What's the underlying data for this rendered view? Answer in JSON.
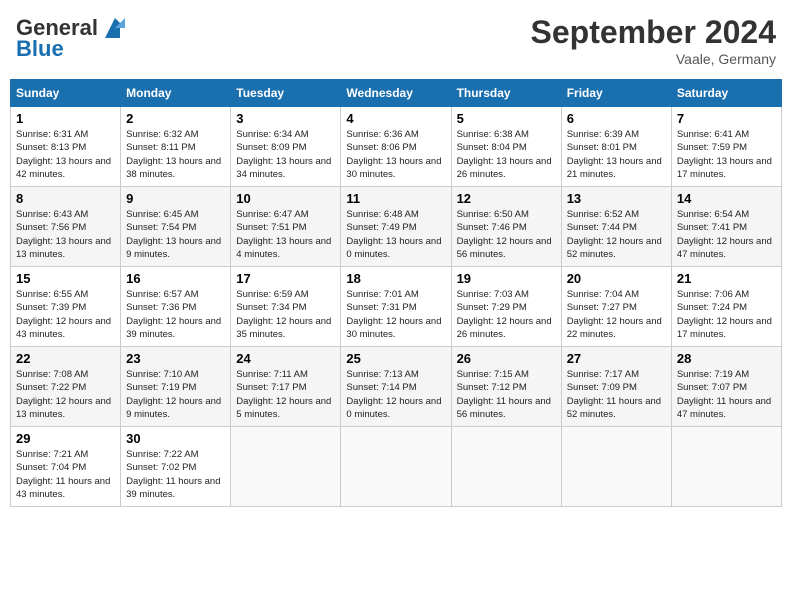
{
  "header": {
    "logo_general": "General",
    "logo_blue": "Blue",
    "month": "September 2024",
    "location": "Vaale, Germany"
  },
  "weekdays": [
    "Sunday",
    "Monday",
    "Tuesday",
    "Wednesday",
    "Thursday",
    "Friday",
    "Saturday"
  ],
  "weeks": [
    [
      {
        "day": "1",
        "sunrise": "Sunrise: 6:31 AM",
        "sunset": "Sunset: 8:13 PM",
        "daylight": "Daylight: 13 hours and 42 minutes."
      },
      {
        "day": "2",
        "sunrise": "Sunrise: 6:32 AM",
        "sunset": "Sunset: 8:11 PM",
        "daylight": "Daylight: 13 hours and 38 minutes."
      },
      {
        "day": "3",
        "sunrise": "Sunrise: 6:34 AM",
        "sunset": "Sunset: 8:09 PM",
        "daylight": "Daylight: 13 hours and 34 minutes."
      },
      {
        "day": "4",
        "sunrise": "Sunrise: 6:36 AM",
        "sunset": "Sunset: 8:06 PM",
        "daylight": "Daylight: 13 hours and 30 minutes."
      },
      {
        "day": "5",
        "sunrise": "Sunrise: 6:38 AM",
        "sunset": "Sunset: 8:04 PM",
        "daylight": "Daylight: 13 hours and 26 minutes."
      },
      {
        "day": "6",
        "sunrise": "Sunrise: 6:39 AM",
        "sunset": "Sunset: 8:01 PM",
        "daylight": "Daylight: 13 hours and 21 minutes."
      },
      {
        "day": "7",
        "sunrise": "Sunrise: 6:41 AM",
        "sunset": "Sunset: 7:59 PM",
        "daylight": "Daylight: 13 hours and 17 minutes."
      }
    ],
    [
      {
        "day": "8",
        "sunrise": "Sunrise: 6:43 AM",
        "sunset": "Sunset: 7:56 PM",
        "daylight": "Daylight: 13 hours and 13 minutes."
      },
      {
        "day": "9",
        "sunrise": "Sunrise: 6:45 AM",
        "sunset": "Sunset: 7:54 PM",
        "daylight": "Daylight: 13 hours and 9 minutes."
      },
      {
        "day": "10",
        "sunrise": "Sunrise: 6:47 AM",
        "sunset": "Sunset: 7:51 PM",
        "daylight": "Daylight: 13 hours and 4 minutes."
      },
      {
        "day": "11",
        "sunrise": "Sunrise: 6:48 AM",
        "sunset": "Sunset: 7:49 PM",
        "daylight": "Daylight: 13 hours and 0 minutes."
      },
      {
        "day": "12",
        "sunrise": "Sunrise: 6:50 AM",
        "sunset": "Sunset: 7:46 PM",
        "daylight": "Daylight: 12 hours and 56 minutes."
      },
      {
        "day": "13",
        "sunrise": "Sunrise: 6:52 AM",
        "sunset": "Sunset: 7:44 PM",
        "daylight": "Daylight: 12 hours and 52 minutes."
      },
      {
        "day": "14",
        "sunrise": "Sunrise: 6:54 AM",
        "sunset": "Sunset: 7:41 PM",
        "daylight": "Daylight: 12 hours and 47 minutes."
      }
    ],
    [
      {
        "day": "15",
        "sunrise": "Sunrise: 6:55 AM",
        "sunset": "Sunset: 7:39 PM",
        "daylight": "Daylight: 12 hours and 43 minutes."
      },
      {
        "day": "16",
        "sunrise": "Sunrise: 6:57 AM",
        "sunset": "Sunset: 7:36 PM",
        "daylight": "Daylight: 12 hours and 39 minutes."
      },
      {
        "day": "17",
        "sunrise": "Sunrise: 6:59 AM",
        "sunset": "Sunset: 7:34 PM",
        "daylight": "Daylight: 12 hours and 35 minutes."
      },
      {
        "day": "18",
        "sunrise": "Sunrise: 7:01 AM",
        "sunset": "Sunset: 7:31 PM",
        "daylight": "Daylight: 12 hours and 30 minutes."
      },
      {
        "day": "19",
        "sunrise": "Sunrise: 7:03 AM",
        "sunset": "Sunset: 7:29 PM",
        "daylight": "Daylight: 12 hours and 26 minutes."
      },
      {
        "day": "20",
        "sunrise": "Sunrise: 7:04 AM",
        "sunset": "Sunset: 7:27 PM",
        "daylight": "Daylight: 12 hours and 22 minutes."
      },
      {
        "day": "21",
        "sunrise": "Sunrise: 7:06 AM",
        "sunset": "Sunset: 7:24 PM",
        "daylight": "Daylight: 12 hours and 17 minutes."
      }
    ],
    [
      {
        "day": "22",
        "sunrise": "Sunrise: 7:08 AM",
        "sunset": "Sunset: 7:22 PM",
        "daylight": "Daylight: 12 hours and 13 minutes."
      },
      {
        "day": "23",
        "sunrise": "Sunrise: 7:10 AM",
        "sunset": "Sunset: 7:19 PM",
        "daylight": "Daylight: 12 hours and 9 minutes."
      },
      {
        "day": "24",
        "sunrise": "Sunrise: 7:11 AM",
        "sunset": "Sunset: 7:17 PM",
        "daylight": "Daylight: 12 hours and 5 minutes."
      },
      {
        "day": "25",
        "sunrise": "Sunrise: 7:13 AM",
        "sunset": "Sunset: 7:14 PM",
        "daylight": "Daylight: 12 hours and 0 minutes."
      },
      {
        "day": "26",
        "sunrise": "Sunrise: 7:15 AM",
        "sunset": "Sunset: 7:12 PM",
        "daylight": "Daylight: 11 hours and 56 minutes."
      },
      {
        "day": "27",
        "sunrise": "Sunrise: 7:17 AM",
        "sunset": "Sunset: 7:09 PM",
        "daylight": "Daylight: 11 hours and 52 minutes."
      },
      {
        "day": "28",
        "sunrise": "Sunrise: 7:19 AM",
        "sunset": "Sunset: 7:07 PM",
        "daylight": "Daylight: 11 hours and 47 minutes."
      }
    ],
    [
      {
        "day": "29",
        "sunrise": "Sunrise: 7:21 AM",
        "sunset": "Sunset: 7:04 PM",
        "daylight": "Daylight: 11 hours and 43 minutes."
      },
      {
        "day": "30",
        "sunrise": "Sunrise: 7:22 AM",
        "sunset": "Sunset: 7:02 PM",
        "daylight": "Daylight: 11 hours and 39 minutes."
      },
      null,
      null,
      null,
      null,
      null
    ]
  ]
}
